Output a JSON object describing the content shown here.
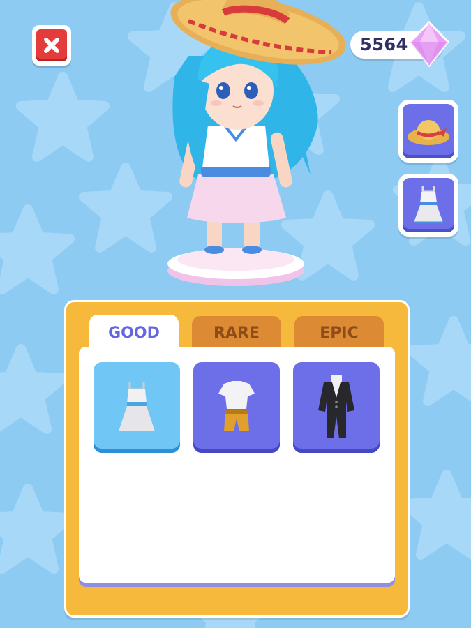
{
  "currency": {
    "amount": "5564",
    "icon": "gem-icon",
    "color": "#e9a0f5"
  },
  "equipped_slots": [
    {
      "name": "hat-slot",
      "icon": "straw-hat-icon"
    },
    {
      "name": "outfit-slot",
      "icon": "dress-icon"
    }
  ],
  "tabs": [
    {
      "label": "GOOD",
      "active": true
    },
    {
      "label": "RARE",
      "active": false
    },
    {
      "label": "EPIC",
      "active": false
    }
  ],
  "items": [
    {
      "icon": "white-dress-icon",
      "rarity": "good"
    },
    {
      "icon": "shirt-shorts-icon",
      "rarity": "rare"
    },
    {
      "icon": "black-suit-icon",
      "rarity": "epic"
    }
  ],
  "colors": {
    "background": "#8ecbf3",
    "panel": "#f6b93b",
    "tab_active_text": "#6468e0",
    "tab_inactive": "#dc8a34",
    "close_button": "#e43b3b"
  }
}
